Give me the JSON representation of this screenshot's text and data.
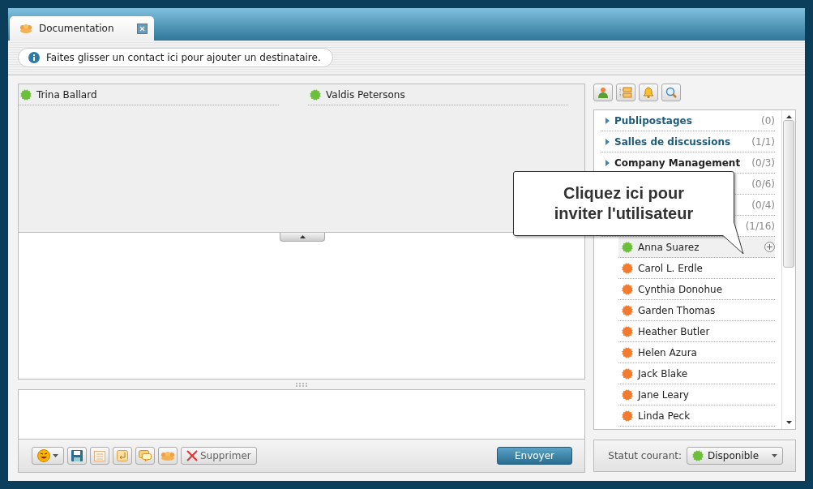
{
  "tab": {
    "title": "Documentation",
    "selected": true
  },
  "info_bar": {
    "text": "Faites glisser un contact ici pour ajouter un destinataire."
  },
  "recipients": [
    {
      "name": "Trina Ballard",
      "color": "#6cbf3a"
    },
    {
      "name": "Valdis Petersons",
      "color": "#6cbf3a"
    }
  ],
  "toolbar": {
    "delete_label": "Supprimer",
    "send_label": "Envoyer"
  },
  "groups": [
    {
      "name": "Publipostages",
      "count": "(0)",
      "expanded": false
    },
    {
      "name": "Salles de discussions",
      "count": "(1/1)",
      "expanded": false
    },
    {
      "name": "Company Management",
      "count": "(0/3)",
      "expanded": false
    },
    {
      "count": "(0/6)"
    },
    {
      "count": "(0/4)"
    },
    {
      "count": "(1/16)"
    }
  ],
  "contacts": [
    {
      "name": "Anna Suarez",
      "color": "#6cbf3a",
      "highlighted": true
    },
    {
      "name": "Carol L. Erdle",
      "color": "#f47a30",
      "highlighted": false
    },
    {
      "name": "Cynthia Donohue",
      "color": "#f47a30",
      "highlighted": false
    },
    {
      "name": "Garden Thomas",
      "color": "#f47a30",
      "highlighted": false
    },
    {
      "name": "Heather Butler",
      "color": "#f47a30",
      "highlighted": false
    },
    {
      "name": "Helen Azura",
      "color": "#f47a30",
      "highlighted": false
    },
    {
      "name": "Jack Blake",
      "color": "#f47a30",
      "highlighted": false
    },
    {
      "name": "Jane Leary",
      "color": "#f47a30",
      "highlighted": false
    },
    {
      "name": "Linda Peck",
      "color": "#f47a30",
      "highlighted": false
    }
  ],
  "tooltip": {
    "text": "Cliquez ici pour inviter l'utilisateur"
  },
  "status_bar": {
    "label": "Statut courant:",
    "value": "Disponible",
    "color": "#6cbf3a"
  }
}
